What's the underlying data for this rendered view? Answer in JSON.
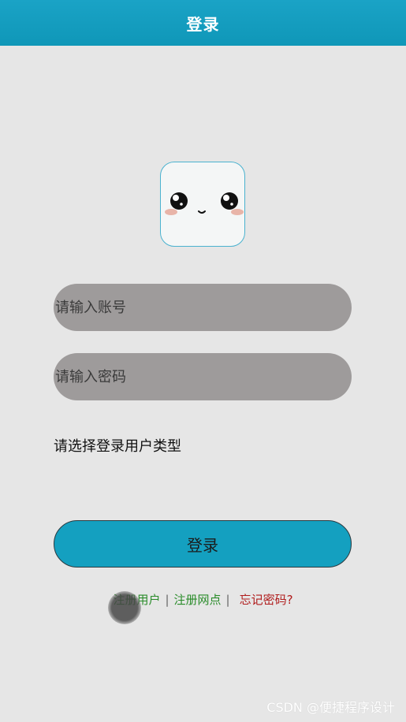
{
  "header": {
    "title": "登录"
  },
  "form": {
    "account_placeholder": "请输入账号",
    "password_placeholder": "请输入密码",
    "user_type_label": "请选择登录用户类型",
    "login_label": "登录"
  },
  "links": {
    "register_user": "注册用户",
    "separator": "|",
    "register_site": "注册网点",
    "forgot_password": "忘记密码?"
  },
  "watermark": "CSDN @便捷程序设计",
  "icons": {
    "avatar": "cute-face-icon"
  },
  "colors": {
    "accent": "#14a0c0",
    "header": "#1aa3c6",
    "background": "#e6e6e6",
    "input": "#9e9b9b",
    "link_green": "#2a8c2a",
    "link_red": "#b01c1c"
  }
}
